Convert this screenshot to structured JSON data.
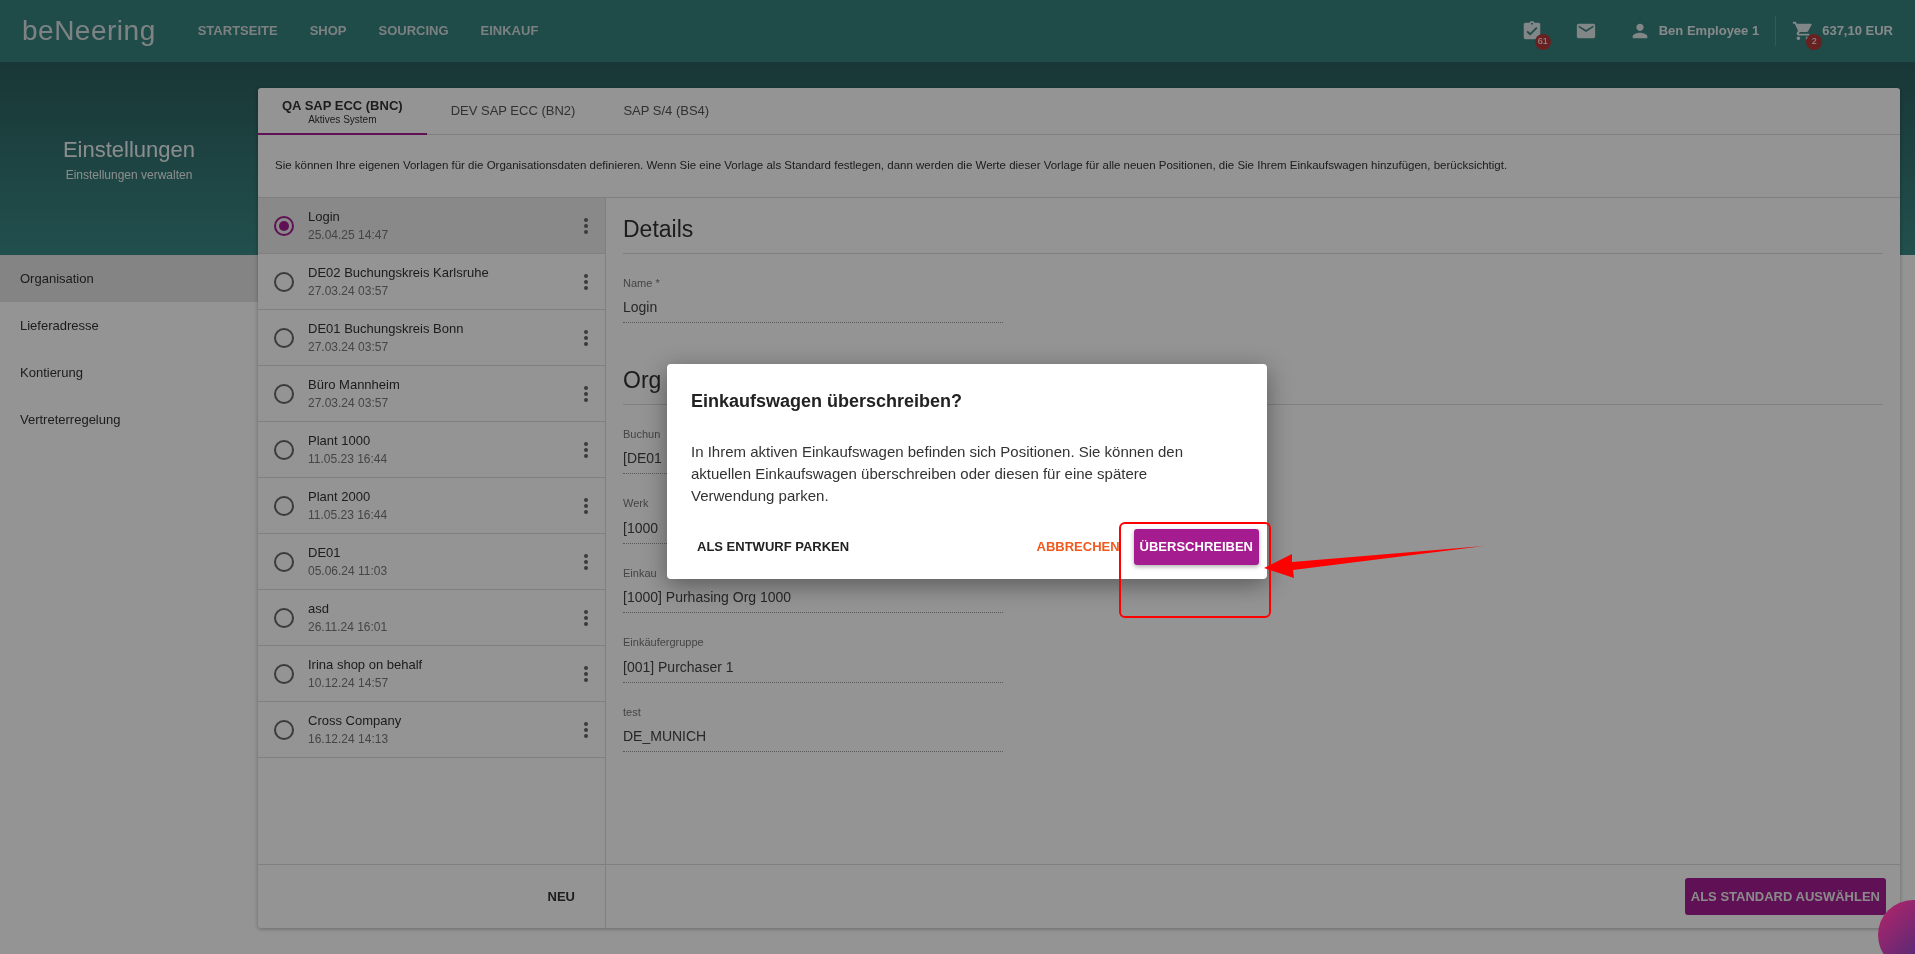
{
  "header": {
    "logo": "beNeering",
    "nav": [
      {
        "label": "STARTSEITE"
      },
      {
        "label": "SHOP"
      },
      {
        "label": "SOURCING"
      },
      {
        "label": "EINKAUF"
      }
    ],
    "tasks_badge": "61",
    "user": "Ben Employee 1",
    "cart_badge": "2",
    "cart_total": "637,10 EUR"
  },
  "page": {
    "title": "Einstellungen",
    "subtitle": "Einstellungen verwalten"
  },
  "sidebar": {
    "items": [
      {
        "label": "Organisation",
        "selected": true
      },
      {
        "label": "Lieferadresse",
        "selected": false
      },
      {
        "label": "Kontierung",
        "selected": false
      },
      {
        "label": "Vertreterregelung",
        "selected": false
      }
    ]
  },
  "tabs": [
    {
      "label": "QA SAP ECC (BNC)",
      "sublabel": "Aktives System",
      "selected": true
    },
    {
      "label": "DEV SAP ECC (BN2)",
      "selected": false
    },
    {
      "label": "SAP S/4 (BS4)",
      "selected": false
    }
  ],
  "description": "Sie können Ihre eigenen Vorlagen für die Organisationsdaten definieren. Wenn Sie eine Vorlage als Standard festlegen, dann werden die Werte dieser Vorlage für alle neuen Positionen, die Sie Ihrem Einkaufswagen hinzufügen, berücksichtigt.",
  "templates": [
    {
      "name": "Login",
      "date": "25.04.25 14:47",
      "selected": true
    },
    {
      "name": "DE02 Buchungskreis Karlsruhe",
      "date": "27.03.24 03:57",
      "selected": false
    },
    {
      "name": "DE01 Buchungskreis Bonn",
      "date": "27.03.24 03:57",
      "selected": false
    },
    {
      "name": "Büro Mannheim",
      "date": "27.03.24 03:57",
      "selected": false
    },
    {
      "name": "Plant 1000",
      "date": "11.05.23 16:44",
      "selected": false
    },
    {
      "name": "Plant 2000",
      "date": "11.05.23 16:44",
      "selected": false
    },
    {
      "name": "DE01",
      "date": "05.06.24 11:03",
      "selected": false
    },
    {
      "name": "asd",
      "date": "26.11.24 16:01",
      "selected": false
    },
    {
      "name": "Irina shop on behalf",
      "date": "10.12.24 14:57",
      "selected": false
    },
    {
      "name": "Cross Company",
      "date": "16.12.24 14:13",
      "selected": false
    }
  ],
  "new_button": "NEU",
  "details": {
    "heading": "Details",
    "name_field": {
      "label": "Name *",
      "value": "Login"
    },
    "org_heading": "Org",
    "fields": [
      {
        "label": "Buchun",
        "value": "[DE01"
      },
      {
        "label": "Werk",
        "value": "[1000"
      },
      {
        "label": "Einkau",
        "value": "[1000] Purhasing Org 1000"
      },
      {
        "label": "Einkäufergruppe",
        "value": "[001] Purchaser 1"
      },
      {
        "label": "test",
        "value": "DE_MUNICH"
      }
    ]
  },
  "default_button": "ALS STANDARD AUSWÄHLEN",
  "dialog": {
    "title": "Einkaufswagen überschreiben?",
    "text": "In Ihrem aktiven Einkaufswagen befinden sich Positionen. Sie können den aktuellen Einkaufswagen überschreiben oder diesen für eine spätere Verwendung parken.",
    "buttons": [
      {
        "label": "ALS ENTWURF PARKEN",
        "kind": "text"
      },
      {
        "label": "ABBRECHEN",
        "kind": "warning"
      },
      {
        "label": "ÜBERSCHREIBEN",
        "kind": "primary"
      }
    ]
  }
}
